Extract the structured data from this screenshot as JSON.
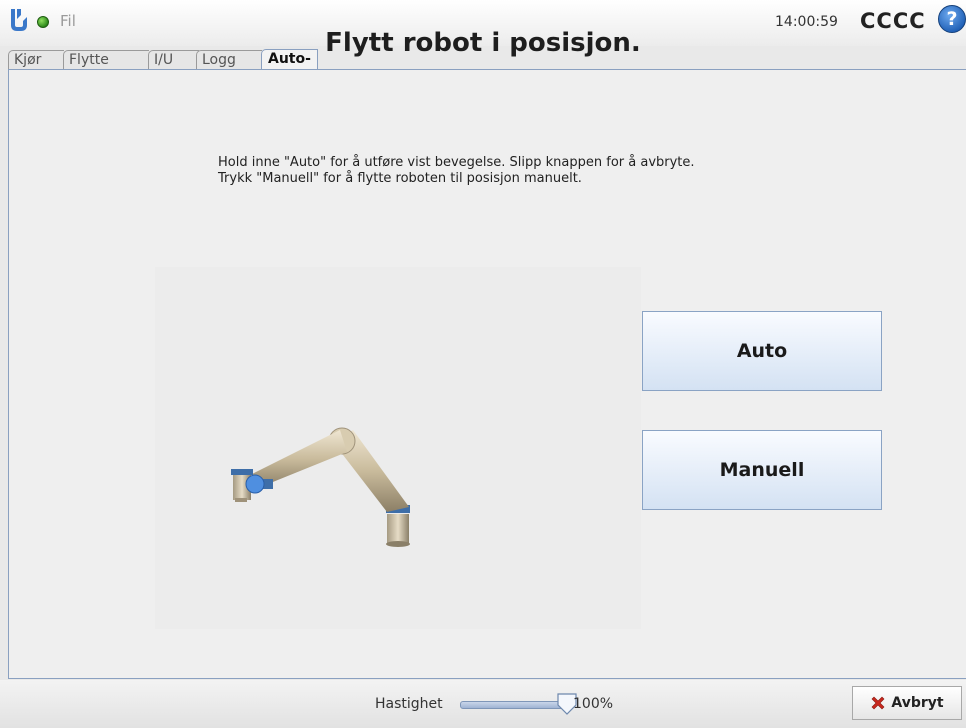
{
  "header": {
    "file_menu": "Fil",
    "clock": "14:00:59",
    "robot_name": "CCCC",
    "help_symbol": "?",
    "status_color": "#3a9a22"
  },
  "tabs": [
    {
      "label": "Kjør",
      "active": false
    },
    {
      "label": "Flytte",
      "active": false
    },
    {
      "label": "I/U",
      "active": false
    },
    {
      "label": "Logg",
      "active": false
    },
    {
      "label": "Auto-flytt",
      "active": true
    }
  ],
  "main": {
    "title": "Flytt robot i posisjon.",
    "instructions": [
      "Hold inne \"Auto\" for å utføre vist bevegelse. Slipp knappen for å avbryte.",
      "Trykk \"Manuell\" for å flytte roboten til posisjon manuelt."
    ],
    "auto_label": "Auto",
    "manual_label": "Manuell"
  },
  "footer": {
    "speed_label": "Hastighet",
    "speed_value": "100%",
    "speed_fraction": 1.0,
    "cancel_label": "Avbryt"
  },
  "icons": {
    "logo": "ur-logo-icon",
    "help": "help-icon",
    "cancel": "red-x-icon"
  },
  "colors": {
    "accent_blue": "#1f5fb5",
    "button_gradient_bottom": "#d4e2f3",
    "cancel_red": "#c8281e"
  }
}
